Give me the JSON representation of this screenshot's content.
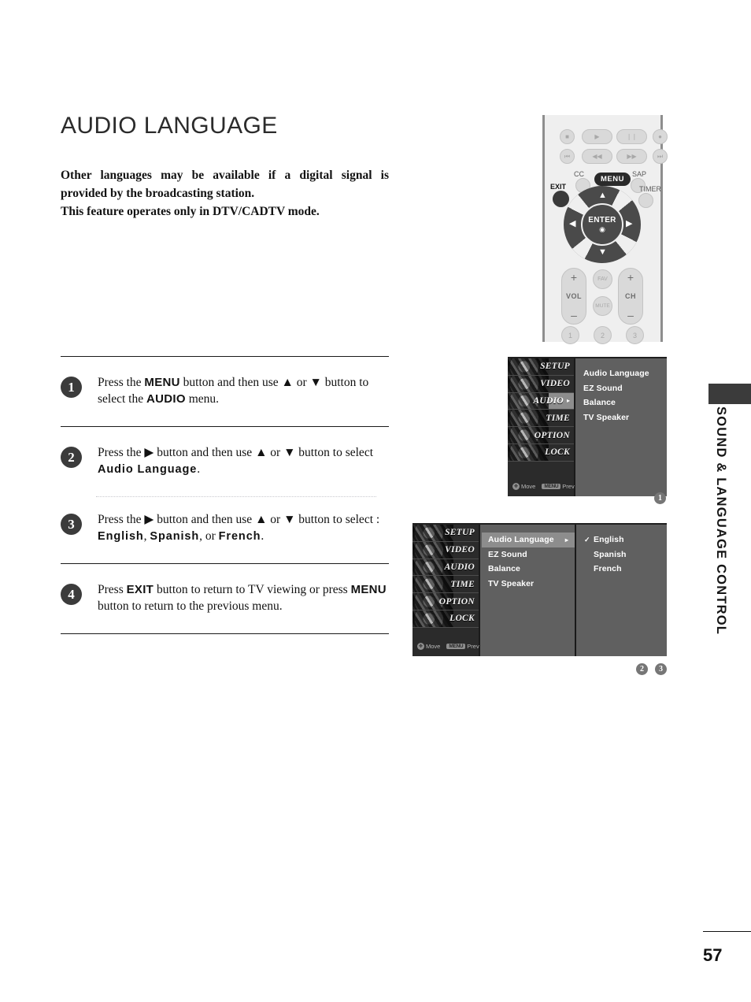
{
  "page": {
    "title": "AUDIO LANGUAGE",
    "number": "57",
    "side_tab": "SOUND & LANGUAGE CONTROL"
  },
  "intro": {
    "line1": "Other languages may be available if a digital signal is",
    "line2": "provided by the broadcasting station.",
    "line3": "This feature operates only in DTV/CADTV mode."
  },
  "steps": [
    {
      "number": "1",
      "part1": "Press the ",
      "key1": "MENU",
      "part2": " button and then use ",
      "up": "▲",
      "part3": " or ",
      "down": "▼",
      "part4": " button to select the ",
      "key2": "AUDIO",
      "part5": " menu."
    },
    {
      "number": "2",
      "part1": "Press the ",
      "key1": "▶",
      "part2": " button and then use ",
      "up": "▲",
      "part3": " or ",
      "down": "▼",
      "part4": " button to select ",
      "key2": "Audio Language",
      "part5": "."
    },
    {
      "number": "3",
      "part1": "Press the ",
      "key1": "▶",
      "part2": " button and then use ",
      "up": "▲",
      "part3": " or ",
      "down": "▼",
      "part4": " button to select : ",
      "opt1": "English",
      "sep1": ", ",
      "opt2": "Spanish",
      "sep2": ", or ",
      "opt3": "French",
      "part5": "."
    },
    {
      "number": "4",
      "part1": "Press ",
      "key1": "EXIT",
      "part2": " button to return to TV viewing or press ",
      "key2": "MENU",
      "part3": " button to return to the previous menu."
    }
  ],
  "remote": {
    "labels": {
      "cc": "CC",
      "sap": "SAP",
      "timer": "TIMER",
      "exit": "EXIT",
      "menu": "MENU",
      "enter": "ENTER",
      "enter_icon": "◉",
      "vol": "VOL",
      "ch": "CH",
      "fav": "FAV",
      "mute": "MUTE",
      "plus": "+",
      "minus": "–",
      "num1": "1",
      "num2": "2",
      "num3": "3",
      "up": "▲",
      "down": "▼",
      "left": "◀",
      "right": "▶"
    },
    "media_row1": [
      "■",
      "▶",
      "❘❘",
      "●"
    ],
    "media_row2": [
      "⏮",
      "◀◀",
      "▶▶",
      "⏭"
    ]
  },
  "osd": {
    "categories": [
      "SETUP",
      "VIDEO",
      "AUDIO",
      "TIME",
      "OPTION",
      "LOCK"
    ],
    "hint_move": "Move",
    "hint_prev": "Prev",
    "hint_move_icon": "✥",
    "hint_prev_icon": "MENU",
    "menu_arrow": "▸",
    "check": "✓",
    "screen1": {
      "active_category": "AUDIO",
      "items": [
        "Audio Language",
        "EZ Sound",
        "Balance",
        "TV Speaker"
      ],
      "callout": "1"
    },
    "screen2": {
      "items": [
        "Audio Language",
        "EZ Sound",
        "Balance",
        "TV Speaker"
      ],
      "selected_item": "Audio Language",
      "options": [
        "English",
        "Spanish",
        "French"
      ],
      "checked_option": "English",
      "callouts": [
        "2",
        "3"
      ]
    }
  }
}
